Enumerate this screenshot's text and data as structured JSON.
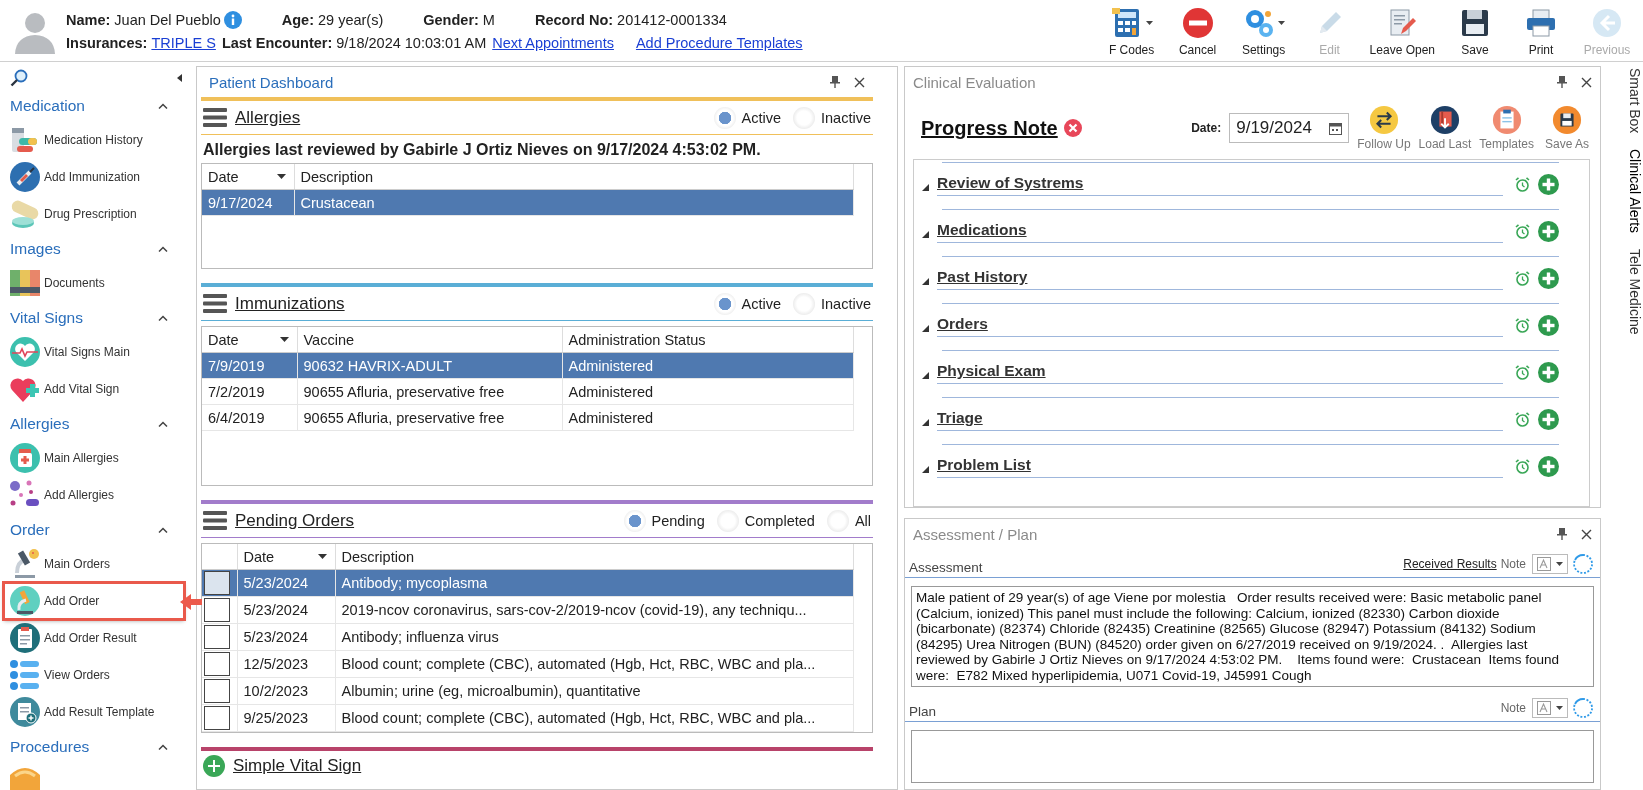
{
  "header": {
    "line1": [
      {
        "label": "Name:",
        "value": "Juan Del Pueblo",
        "info": true,
        "link": false
      },
      {
        "label": "Age:",
        "value": "29 year(s)",
        "info": false,
        "link": false
      },
      {
        "label": "Gender:",
        "value": "M",
        "info": false,
        "link": false
      },
      {
        "label": "Record No:",
        "value": "201412-0001334",
        "info": false,
        "link": false
      }
    ],
    "line2": [
      {
        "label": "Insurances:",
        "value": "TRIPLE S",
        "info": false,
        "link": true
      },
      {
        "label": "Last Encounter:",
        "value": "9/18/2024 10:03:01 AM",
        "info": false,
        "link": false
      }
    ],
    "links": [
      "Next Appointments",
      "Add Procedure Templates"
    ]
  },
  "toolbar": [
    {
      "label": "F Codes",
      "kind": "fcodes",
      "dropdown": true,
      "disabled": false
    },
    {
      "label": "Cancel",
      "kind": "cancel",
      "dropdown": false,
      "disabled": false
    },
    {
      "label": "Settings",
      "kind": "settings",
      "dropdown": true,
      "disabled": false
    },
    {
      "label": "Edit",
      "kind": "edit",
      "dropdown": false,
      "disabled": true
    },
    {
      "label": "Leave Open",
      "kind": "leave",
      "dropdown": false,
      "disabled": false
    },
    {
      "label": "Save",
      "kind": "save",
      "dropdown": false,
      "disabled": false
    },
    {
      "label": "Print",
      "kind": "print",
      "dropdown": false,
      "disabled": false
    },
    {
      "label": "Previous",
      "kind": "previous",
      "dropdown": false,
      "disabled": true
    }
  ],
  "sidebar": {
    "sections": [
      {
        "title": "Medication",
        "expanded": true,
        "items": [
          {
            "label": "Medication History",
            "kind": "pills",
            "highlighted": false
          },
          {
            "label": "Add Immunization",
            "kind": "syringe",
            "highlighted": false
          },
          {
            "label": "Drug Prescription",
            "kind": "capsule",
            "highlighted": false
          }
        ]
      },
      {
        "title": "Images",
        "expanded": true,
        "items": [
          {
            "label": "Documents",
            "kind": "binders",
            "highlighted": false
          }
        ]
      },
      {
        "title": "Vital Signs",
        "expanded": true,
        "items": [
          {
            "label": "Vital Signs Main",
            "kind": "heartbeat",
            "highlighted": false
          },
          {
            "label": "Add Vital Sign",
            "kind": "heartplus",
            "highlighted": false
          }
        ]
      },
      {
        "title": "Allergies",
        "expanded": true,
        "items": [
          {
            "label": "Main Allergies",
            "kind": "bottle",
            "highlighted": false
          },
          {
            "label": "Add Allergies",
            "kind": "dots",
            "highlighted": false
          }
        ]
      },
      {
        "title": "Order",
        "expanded": true,
        "items": [
          {
            "label": "Main Orders",
            "kind": "microscope",
            "highlighted": false
          },
          {
            "label": "Add Order",
            "kind": "microscope2",
            "highlighted": true
          },
          {
            "label": "Add Order Result",
            "kind": "clipboard",
            "highlighted": false
          },
          {
            "label": "View Orders",
            "kind": "list",
            "highlighted": false
          },
          {
            "label": "Add Result Template",
            "kind": "template",
            "highlighted": false
          }
        ]
      },
      {
        "title": "Procedures",
        "expanded": true,
        "items": [
          {
            "kind": "procedure",
            "highlighted": false
          }
        ]
      }
    ]
  },
  "dashboard": {
    "title": "Patient Dashboard",
    "sections": [
      {
        "kind": "allergies",
        "title": "Allergies",
        "color": "#f0c05a",
        "filters": [
          {
            "label": "Active",
            "selected": true
          },
          {
            "label": "Inactive",
            "selected": false
          }
        ],
        "note": "Allergies last reviewed by Gabirle J Ortiz Nieves on 9/17/2024 4:53:02 PM.",
        "columns": [
          {
            "label": "Date",
            "sort": true
          },
          {
            "label": "Description",
            "sort": false
          }
        ],
        "rows": [
          {
            "selected": true,
            "cells": [
              "9/17/2024",
              "Crustacean"
            ]
          }
        ]
      },
      {
        "kind": "immunizations",
        "title": "Immunizations",
        "color": "#5aaed6",
        "filters": [
          {
            "label": "Active",
            "selected": true
          },
          {
            "label": "Inactive",
            "selected": false
          }
        ],
        "columns": [
          {
            "label": "Date",
            "sort": true
          },
          {
            "label": "Vaccine",
            "sort": false
          },
          {
            "label": "Administration Status",
            "sort": false
          }
        ],
        "rows": [
          {
            "selected": true,
            "cells": [
              "7/9/2019",
              "90632 HAVRIX-ADULT",
              "Administered"
            ]
          },
          {
            "selected": false,
            "cells": [
              "7/2/2019",
              "90655 Afluria, preservative free",
              "Administered"
            ]
          },
          {
            "selected": false,
            "cells": [
              "6/4/2019",
              "90655 Afluria, preservative free",
              "Administered"
            ]
          }
        ]
      },
      {
        "kind": "orders",
        "title": "Pending Orders",
        "color": "#a27ccb",
        "filters": [
          {
            "label": "Pending",
            "selected": true
          },
          {
            "label": "Completed",
            "selected": false
          },
          {
            "label": "All",
            "selected": false
          }
        ],
        "columns": [
          {
            "label": "Date",
            "sort": true
          },
          {
            "label": "Description",
            "sort": false
          }
        ],
        "rows": [
          {
            "selected": true,
            "checked": false,
            "cells": [
              "5/23/2024",
              "Antibody; mycoplasma"
            ]
          },
          {
            "selected": false,
            "checked": false,
            "cells": [
              "5/23/2024",
              "2019-ncov coronavirus, sars-cov-2/2019-ncov (covid-19), any techniqu..."
            ]
          },
          {
            "selected": false,
            "checked": false,
            "cells": [
              "5/23/2024",
              "Antibody; influenza virus"
            ]
          },
          {
            "selected": false,
            "checked": false,
            "cells": [
              "12/5/2023",
              "Blood count; complete (CBC), automated (Hgb, Hct, RBC, WBC and pla..."
            ]
          },
          {
            "selected": false,
            "checked": false,
            "cells": [
              "10/2/2023",
              "Albumin; urine (eg, microalbumin), quantitative"
            ]
          },
          {
            "selected": false,
            "checked": false,
            "cells": [
              "9/25/2023",
              "Blood count; complete (CBC), automated (Hgb, Hct, RBC, WBC and pla..."
            ]
          }
        ]
      },
      {
        "kind": "add",
        "title": "Simple Vital Sign",
        "color": "#b8436a"
      }
    ]
  },
  "clinical": {
    "title": "Clinical Evaluation",
    "note_title": "Progress Note",
    "date_label": "Date:",
    "date": "9/19/2024",
    "actions": [
      {
        "label": "Follow Up",
        "kind": "followup"
      },
      {
        "label": "Load Last",
        "kind": "loadlast"
      },
      {
        "label": "Templates",
        "kind": "templates"
      },
      {
        "label": "Save As",
        "kind": "saveas"
      }
    ],
    "sections": [
      {
        "title": "Review of Systrems",
        "expanded": true
      },
      {
        "title": "Medications",
        "expanded": true
      },
      {
        "title": "Past History",
        "expanded": true
      },
      {
        "title": "Orders",
        "expanded": true
      },
      {
        "title": "Physical Exam",
        "expanded": true
      },
      {
        "title": "Triage",
        "expanded": true
      },
      {
        "title": "Problem List",
        "expanded": true
      }
    ]
  },
  "assessment_plan": {
    "title": "Assessment / Plan",
    "assessment": {
      "label": "Assessment",
      "link": "Received Results",
      "note_label": "Note",
      "text": "Male patient of 29 year(s) of age Viene por molestia   Order results received were: Basic metabolic panel (Calcium, ionized) This panel must include the following: Calcium, ionized (82330) Carbon dioxide (bicarbonate) (82374) Chloride (82435) Creatinine (82565) Glucose (82947) Potassium (84132) Sodium (84295) Urea Nitrogen (BUN) (84520) order given on 6/27/2019 received on 9/19/2024. .  Allergies last reviewed by Gabirle J Ortiz Nieves on 9/17/2024 4:53:02 PM.    Items found were:  Crustacean  Items found were:  E782 Mixed hyperlipidemia, U071 Covid-19, J45991 Cough"
    },
    "plan": {
      "label": "Plan",
      "note_label": "Note"
    }
  },
  "side_tabs": [
    {
      "label": "Smart Box",
      "selected": false
    },
    {
      "label": "Clinical Alerts",
      "selected": true
    },
    {
      "label": "Tele Medicine",
      "selected": false
    }
  ]
}
